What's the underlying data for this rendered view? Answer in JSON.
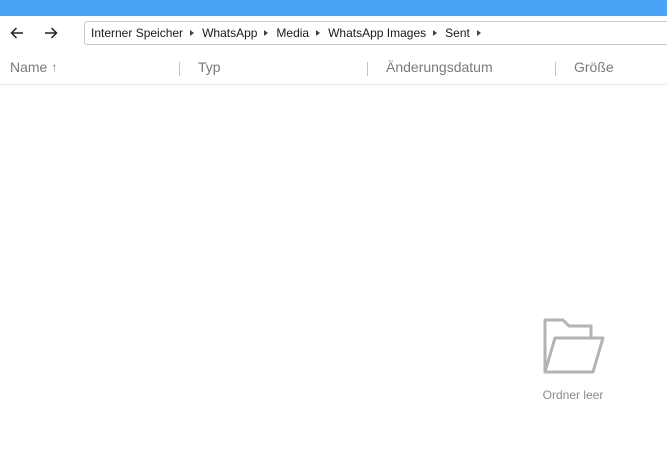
{
  "colors": {
    "accent": "#4aa3f5",
    "header_text": "#7a7a7a",
    "empty_text": "#8a8a8a"
  },
  "navigation": {
    "back_icon": "arrow-left-icon",
    "forward_icon": "arrow-right-icon"
  },
  "breadcrumb": [
    "Interner Speicher",
    "WhatsApp",
    "Media",
    "WhatsApp Images",
    "Sent"
  ],
  "columns": {
    "name": "Name",
    "type": "Typ",
    "modified": "Änderungsdatum",
    "size": "Größe",
    "sort_icon": "sort-ascending-icon",
    "sort_arrow": "↑"
  },
  "empty_state": {
    "icon": "folder-open-icon",
    "label": "Ordner leer"
  }
}
